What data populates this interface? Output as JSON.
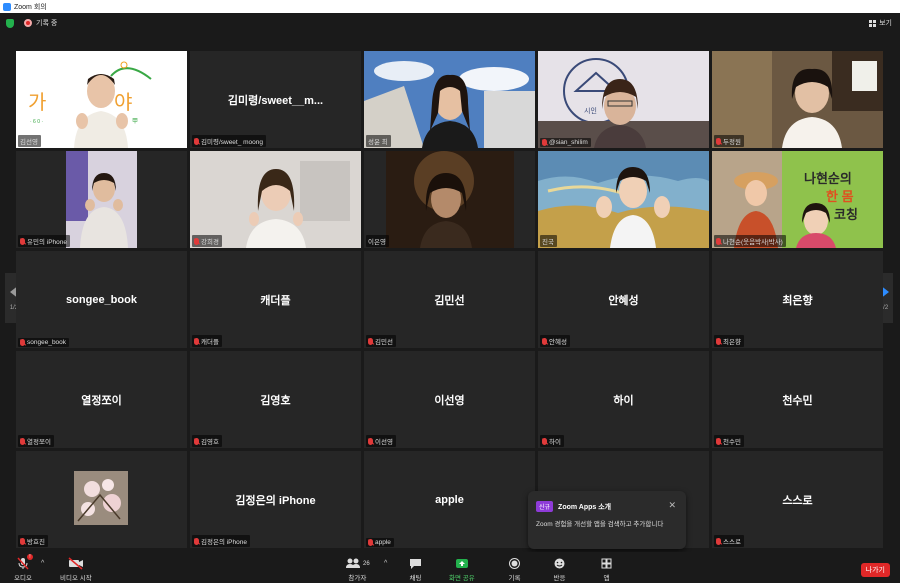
{
  "window": {
    "title": "Zoom 회의"
  },
  "meeting": {
    "recording_text": "기록 중",
    "view_label": "보기"
  },
  "nav": {
    "left_page": "1/2",
    "right_page": "1/2"
  },
  "tiles": [
    {
      "name": "",
      "label": "김선영"
    },
    {
      "name": "김미령/sweet__m...",
      "label": "김미령/sweet_ moong"
    },
    {
      "name": "",
      "label": "성윤 최"
    },
    {
      "name": "",
      "label": "@sian_shilim"
    },
    {
      "name": "",
      "label": "두정원"
    },
    {
      "name": "",
      "label": "유민의 iPhone"
    },
    {
      "name": "",
      "label": "강희경"
    },
    {
      "name": "",
      "label": "이은영"
    },
    {
      "name": "",
      "label": "진국"
    },
    {
      "name": "",
      "label": "나현순(웃음박사|박사)"
    },
    {
      "name": "songee_book",
      "label": "songee_book"
    },
    {
      "name": "캐더플",
      "label": "캐더플"
    },
    {
      "name": "김민선",
      "label": "김민선"
    },
    {
      "name": "안혜성",
      "label": "안혜성"
    },
    {
      "name": "최은향",
      "label": "최은향"
    },
    {
      "name": "열정쪼이",
      "label": "열정쪼이"
    },
    {
      "name": "김영호",
      "label": "김영호"
    },
    {
      "name": "이선영",
      "label": "이선영"
    },
    {
      "name": "하이",
      "label": "하이"
    },
    {
      "name": "천수민",
      "label": "천수민"
    },
    {
      "name": "",
      "label": "방효진"
    },
    {
      "name": "김정은의 iPhone",
      "label": "김정은의 iPhone"
    },
    {
      "name": "apple",
      "label": "apple"
    },
    {
      "name": "",
      "label": ""
    },
    {
      "name": "스스로",
      "label": "스스로"
    }
  ],
  "tile_extras": {
    "logo_text_1": "가",
    "logo_text_2": "야",
    "logo_sub": "· 6 0 ·",
    "logo_han": "甲",
    "sign_text": "시인",
    "banner_text_1": "나현순의",
    "banner_text_2": "한 몸",
    "banner_text_3": "코칭"
  },
  "popup": {
    "badge": "신규",
    "title": "Zoom Apps 소개",
    "body": "Zoom 경험을 개선할 앱을 검색하고 추가합니다"
  },
  "toolbar": {
    "audio": "오디오",
    "video": "비디오 시작",
    "participants": "참가자",
    "participants_count": "26",
    "chat": "채팅",
    "share": "화면 공유",
    "record": "기록",
    "reactions": "반응",
    "apps": "앱",
    "leave": "나가기",
    "audio_badge": "!"
  },
  "colors": {
    "tile_bg": "#262626",
    "active_border": "#c8e54a",
    "share_green": "#23b14d",
    "leave_red": "#e02828",
    "accent_blue": "#2d8cff"
  }
}
